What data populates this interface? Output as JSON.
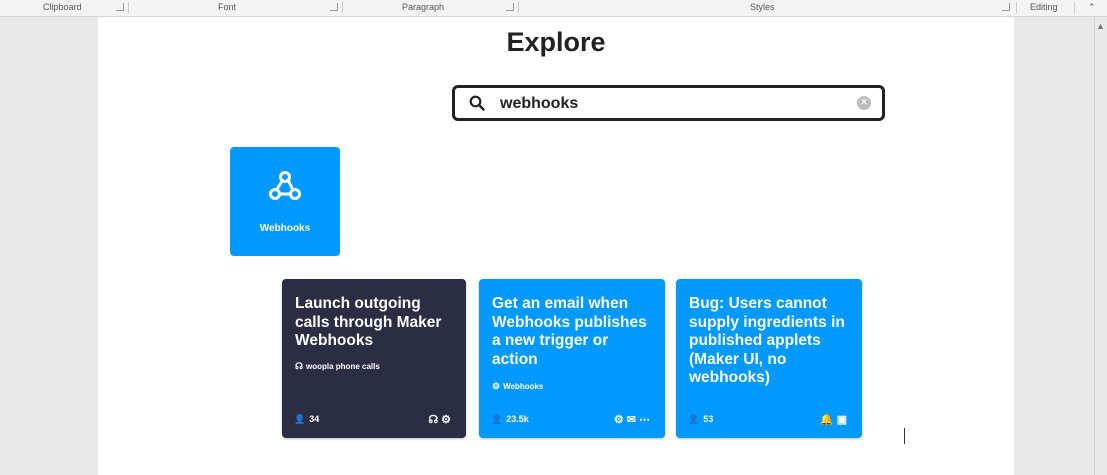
{
  "ribbon": {
    "groups": [
      "Clipboard",
      "Font",
      "Paragraph",
      "Styles",
      "Editing"
    ]
  },
  "page": {
    "title": "Explore",
    "search": {
      "value": "webhooks"
    },
    "service": {
      "name": "Webhooks",
      "icon": "webhooks-icon"
    },
    "cards": [
      {
        "title": "Launch outgoing calls through Maker Webhooks",
        "byline": "woopla phone calls",
        "users": "34",
        "color": "#2a2d44",
        "icons": [
          "woopla-icon",
          "webhooks-icon"
        ]
      },
      {
        "title": "Get an email when Webhooks publishes a new trigger or action",
        "byline": "Webhooks",
        "users": "23.5k",
        "color": "#0099ff",
        "icons": [
          "webhooks-icon",
          "email-icon",
          "more-icon"
        ]
      },
      {
        "title": "Bug: Users cannot supply ingredients in published applets (Maker UI, no webhooks)",
        "byline": "",
        "users": "53",
        "color": "#0099ff",
        "icons": [
          "notification-icon",
          "calendar-icon"
        ]
      }
    ]
  }
}
